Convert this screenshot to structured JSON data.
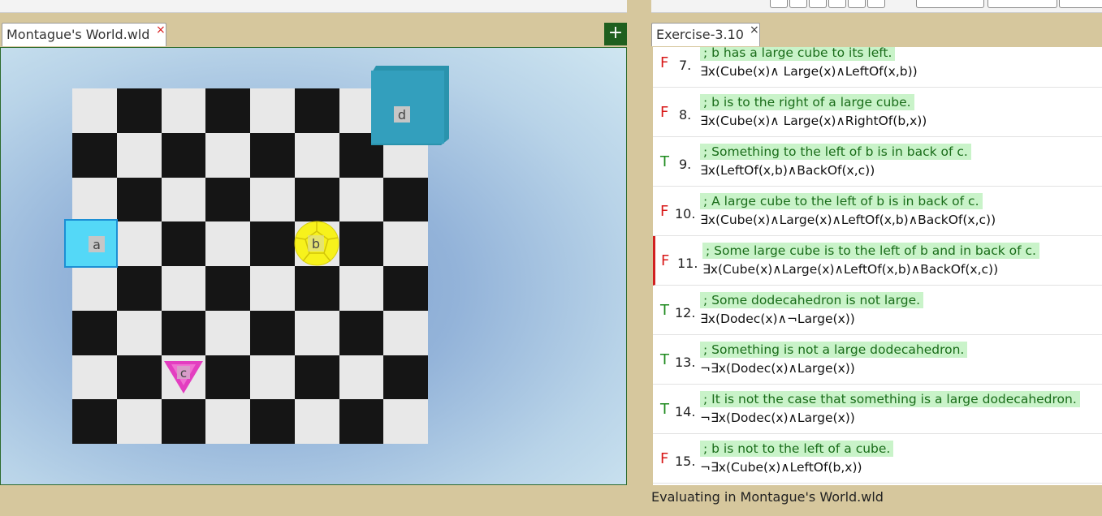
{
  "world_tab": {
    "label": "Montague's World.wld",
    "close": "×"
  },
  "add_button": {
    "label": "+"
  },
  "sentence_tab": {
    "label": "Exercise-3.10",
    "close": "×"
  },
  "world": {
    "objects": [
      {
        "name": "a",
        "shape": "cube",
        "size": "medium",
        "color": "#4fd6f5"
      },
      {
        "name": "b",
        "shape": "dodecahedron",
        "size": "medium",
        "color": "#f2ee1a"
      },
      {
        "name": "c",
        "shape": "tetrahedron",
        "size": "small",
        "color": "#ea3fbf"
      },
      {
        "name": "d",
        "shape": "cube",
        "size": "large",
        "color": "#2f9fba"
      }
    ]
  },
  "sentences": [
    {
      "truth": "F",
      "number": "7.",
      "comment": "; b has a large cube to its left.",
      "formula": "∃x(Cube(x)∧ Large(x)∧LeftOf(x,b))"
    },
    {
      "truth": "F",
      "number": "8.",
      "comment": "; b is to the right of a large cube.",
      "formula": "∃x(Cube(x)∧ Large(x)∧RightOf(b,x))"
    },
    {
      "truth": "T",
      "number": "9.",
      "comment": "; Something to the left of b is in back of c.",
      "formula": "∃x(LeftOf(x,b)∧BackOf(x,c))"
    },
    {
      "truth": "F",
      "number": "10.",
      "comment": "; A large cube to the left of b is in back of c.",
      "formula": "∃x(Cube(x)∧Large(x)∧LeftOf(x,b)∧BackOf(x,c))"
    },
    {
      "truth": "F",
      "number": "11.",
      "comment": "; Some large cube is to the left of b and in back of c.",
      "formula": "∃x(Cube(x)∧Large(x)∧LeftOf(x,b)∧BackOf(x,c))",
      "active": true
    },
    {
      "truth": "T",
      "number": "12.",
      "comment": "; Some dodecahedron is not large.",
      "formula": "∃x(Dodec(x)∧¬Large(x))"
    },
    {
      "truth": "T",
      "number": "13.",
      "comment": "; Something is not a large dodecahedron.",
      "formula": "¬∃x(Dodec(x)∧Large(x))"
    },
    {
      "truth": "T",
      "number": "14.",
      "comment": "; It is not the case that something is a large dodecahedron.",
      "formula": "¬∃x(Dodec(x)∧Large(x))"
    },
    {
      "truth": "F",
      "number": "15.",
      "comment": "; b is not to the left of a cube.",
      "formula": "¬∃x(Cube(x)∧LeftOf(b,x))"
    }
  ],
  "status": "Evaluating in Montague's World.wld"
}
